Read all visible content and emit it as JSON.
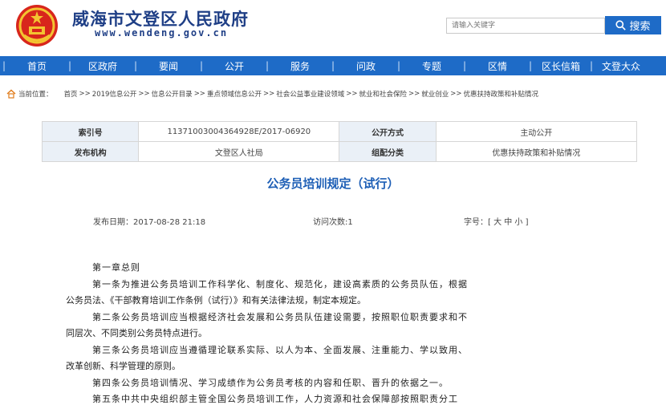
{
  "header": {
    "site_title": "威海市文登区人民政府",
    "site_url": "www.wendeng.gov.cn",
    "emblem_icon": "national-emblem-icon"
  },
  "search": {
    "placeholder": "请输入关键字",
    "button_label": "搜索",
    "icon": "search-icon"
  },
  "colors": {
    "brand_blue": "#1e6bc7",
    "title_blue": "#1f3f86",
    "table_header_bg": "#eaf0f7"
  },
  "nav": {
    "items": [
      "首页",
      "区政府",
      "要闻",
      "公开",
      "服务",
      "问政",
      "专题",
      "区情",
      "区长信箱",
      "文登大众"
    ]
  },
  "breadcrumb": {
    "label": "当前位置：",
    "items": [
      "首页",
      "2019信息公开",
      "信息公开目录",
      "重点领域信息公开",
      "社会公益事业建设领域",
      "就业和社会保险",
      "就业创业",
      "优惠扶持政策和补贴情况"
    ]
  },
  "info": {
    "index_label": "索引号",
    "index_value": "11371003004364928E/2017-06920",
    "disclosure_label": "公开方式",
    "disclosure_value": "主动公开",
    "publisher_label": "发布机构",
    "publisher_value": "文登区人社局",
    "category_label": "组配分类",
    "category_value": "优惠扶持政策和补贴情况"
  },
  "article": {
    "title": "公务员培训规定（试行）",
    "publish_date": "发布日期：2017-08-28 21:18",
    "visits": "访问次数:1",
    "font_size_label": "字号：[ 大 中 小 ]",
    "chapter": "第一章总则",
    "p1a": "第一条为推进公务员培训工作科学化、制度化、规范化，建设高素质的公务员队伍，根据",
    "p1b": "公务员法、《干部教育培训工作条例（试行）》和有关法律法规，制定本规定。",
    "p2a": "第二条公务员培训应当根据经济社会发展和公务员队伍建设需要，按照职位职责要求和不",
    "p2b": "同层次、不同类别公务员特点进行。",
    "p3a": "第三条公务员培训应当遵循理论联系实际、以人为本、全面发展、注重能力、学以致用、",
    "p3b": "改革创新、科学管理的原则。",
    "p4": "第四条公务员培训情况、学习成绩作为公务员考核的内容和任职、晋升的依据之一。",
    "p5": "第五条中共中央组织部主管全国公务员培训工作，人力资源和社会保障部按照职责分工"
  }
}
